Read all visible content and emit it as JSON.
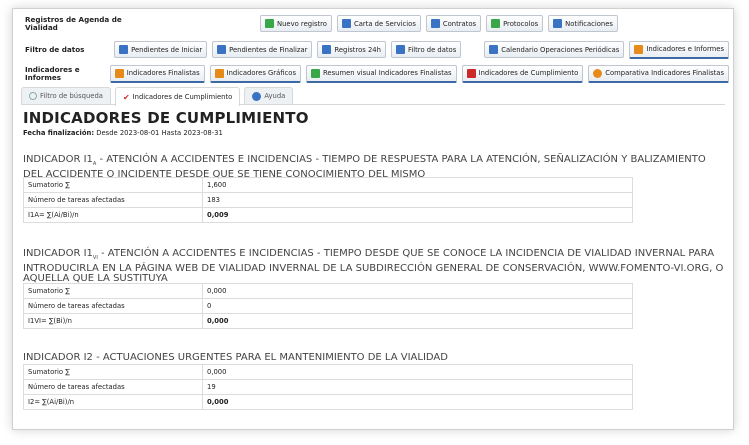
{
  "menu": {
    "row1": {
      "label": "Registros de Agenda de Vialidad",
      "buttons": [
        "Nuevo registro",
        "Carta de Servicios",
        "Contratos",
        "Protocolos",
        "Notificaciones"
      ]
    },
    "row2": {
      "label": "Filtro de datos",
      "buttons": [
        "Pendientes de Iniciar",
        "Pendientes de Finalizar",
        "Registros 24h",
        "Filtro de datos",
        "Calendario Operaciones Periódicas",
        "Indicadores e Informes"
      ]
    },
    "row3": {
      "label": "Indicadores e Informes",
      "buttons": [
        "Indicadores Finalistas",
        "Indicadores Gráficos",
        "Resumen visual Indicadores Finalistas",
        "Indicadores de Cumplimiento",
        "Comparativa Indicadores Finalistas"
      ]
    }
  },
  "tabs": [
    "Filtro de búsqueda",
    "Indicadores de Cumplimiento",
    "Ayuda"
  ],
  "title": "INDICADORES DE CUMPLIMIENTO",
  "date_label": "Fecha finalización:",
  "date_value": "Desde 2023-08-01 Hasta 2023-08-31",
  "indicators": [
    {
      "heading_pre": "INDICADOR I1",
      "heading_sub": "A",
      "heading_rest": " - ATENCIÓN A ACCIDENTES E INCIDENCIAS - TIEMPO DE RESPUESTA PARA LA ATENCIÓN, SEÑALIZACIÓN Y BALIZAMIENTO DEL ACCIDENTE O INCIDENTE DESDE QUE SE TIENE CONOCIMIENTO DEL MISMO",
      "rows": [
        {
          "k": "Sumatorio ∑",
          "v": "1,600"
        },
        {
          "k": "Número de tareas afectadas",
          "v": "183"
        },
        {
          "k": "I1A= ∑(Ai/Bi)/n",
          "v": "0,009"
        }
      ]
    },
    {
      "heading_pre": "INDICADOR I1",
      "heading_sub": "VI",
      "heading_rest": " - ATENCIÓN A ACCIDENTES E INCIDENCIAS - TIEMPO DESDE QUE SE CONOCE LA INCIDENCIA DE VIALIDAD INVERNAL PARA INTRODUCIRLA EN LA PÁGINA WEB DE VIALIDAD INVERNAL DE LA SUBDIRECCIÓN GENERAL DE CONSERVACIÓN, WWW.FOMENTO-VI.ORG, O AQUELLA QUE LA SUSTITUYA",
      "rows": [
        {
          "k": "Sumatorio ∑",
          "v": "0,000"
        },
        {
          "k": "Número de tareas afectadas",
          "v": "0"
        },
        {
          "k": "I1VI= ∑(Bi)/n",
          "v": "0,000"
        }
      ]
    },
    {
      "heading_pre": "INDICADOR I2",
      "heading_sub": "",
      "heading_rest": " - ACTUACIONES URGENTES PARA EL MANTENIMIENTO DE LA VIALIDAD",
      "rows": [
        {
          "k": "Sumatorio ∑",
          "v": "0,000"
        },
        {
          "k": "Número de tareas afectadas",
          "v": "19"
        },
        {
          "k": "I2= ∑(Ai/Bi)/n",
          "v": "0,000"
        }
      ]
    }
  ]
}
